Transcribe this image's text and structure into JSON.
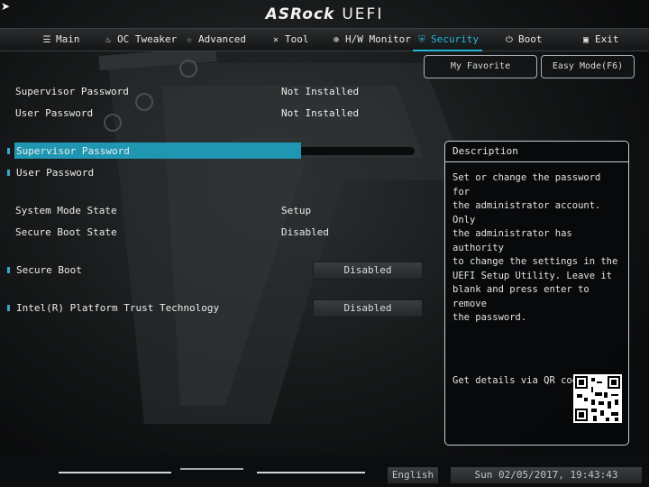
{
  "brand": {
    "name": "ASRock",
    "product": "UEFI"
  },
  "nav": [
    {
      "label": "Main",
      "icon": "list-icon"
    },
    {
      "label": "OC Tweaker",
      "icon": "flame-icon"
    },
    {
      "label": "Advanced",
      "icon": "star-icon"
    },
    {
      "label": "Tool",
      "icon": "tools-icon"
    },
    {
      "label": "H/W Monitor",
      "icon": "monitor-icon"
    },
    {
      "label": "Security",
      "icon": "shield-icon",
      "active": true
    },
    {
      "label": "Boot",
      "icon": "power-icon"
    },
    {
      "label": "Exit",
      "icon": "exit-icon"
    }
  ],
  "top_buttons": {
    "favorite": "My Favorite",
    "easy_mode": "Easy Mode(F6)"
  },
  "status": {
    "supervisor_label": "Supervisor Password",
    "supervisor_value": "Not Installed",
    "user_label": "User Password",
    "user_value": "Not Installed"
  },
  "actions": {
    "supervisor_password": "Supervisor Password",
    "user_password": "User Password"
  },
  "state": {
    "system_mode_label": "System Mode State",
    "system_mode_value": "Setup",
    "secure_boot_state_label": "Secure Boot State",
    "secure_boot_state_value": "Disabled"
  },
  "settings": {
    "secure_boot_label": "Secure Boot",
    "secure_boot_value": "Disabled",
    "ptt_label": "Intel(R) Platform Trust Technology",
    "ptt_value": "Disabled"
  },
  "description": {
    "title": "Description",
    "lines": [
      "Set or change the password for",
      "the administrator account. Only",
      "the administrator has authority",
      "to change the settings in the",
      "UEFI Setup Utility. Leave it",
      "blank and press enter to remove",
      "the password."
    ],
    "qr_label": "Get details via QR code"
  },
  "footer": {
    "language": "English",
    "datetime": "Sun 02/05/2017, 19:43:43"
  },
  "colors": {
    "accent": "#22b7dc",
    "selection": "#1f97b3"
  }
}
